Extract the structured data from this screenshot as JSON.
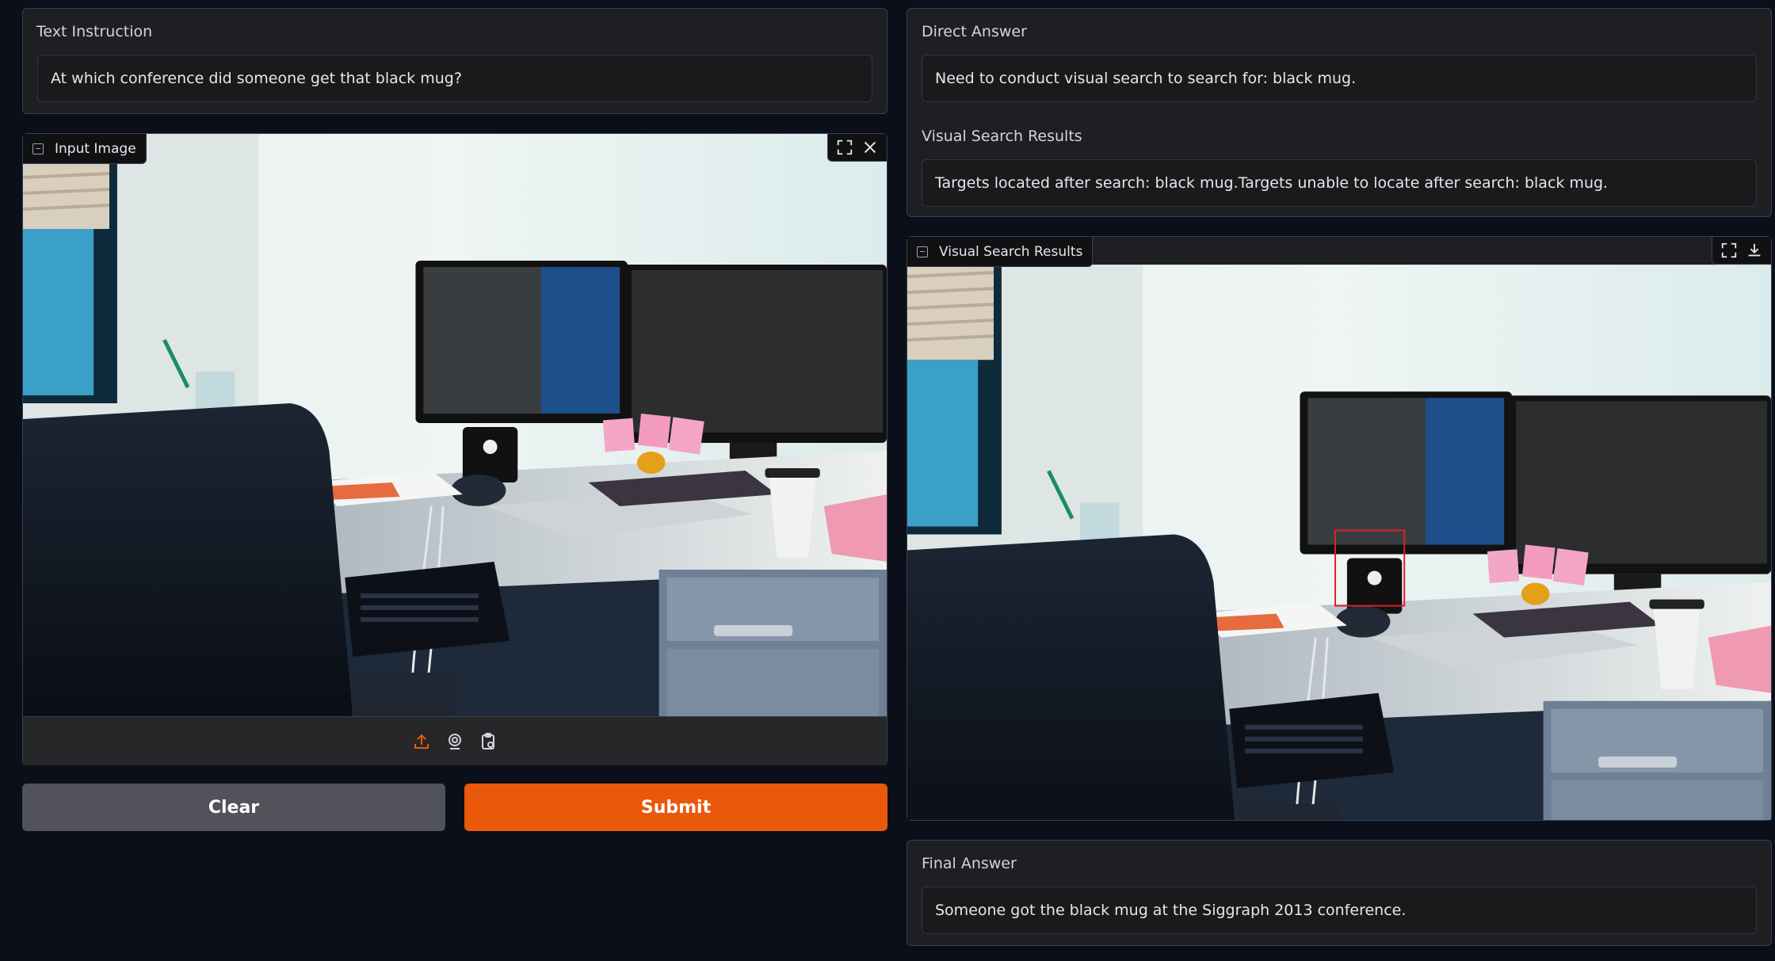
{
  "text_instruction": {
    "label": "Text Instruction",
    "value": "At which conference did someone get that black mug?"
  },
  "input_image": {
    "label": "Input Image"
  },
  "buttons": {
    "clear": "Clear",
    "submit": "Submit"
  },
  "direct_answer": {
    "label": "Direct Answer",
    "value": "Need to conduct visual search to search for: black mug."
  },
  "visual_search_text": {
    "label": "Visual Search Results",
    "value": "Targets located after search: black mug.Targets unable to locate after search: black mug."
  },
  "visual_search_image": {
    "label": "Visual Search Results"
  },
  "final_answer": {
    "label": "Final Answer",
    "value": "Someone got the black mug at the Siggraph 2013 conference."
  },
  "colors": {
    "accent": "#ea580c",
    "clear_button": "#52525b",
    "background": "#0b0f19",
    "panel": "#1f1f23"
  }
}
